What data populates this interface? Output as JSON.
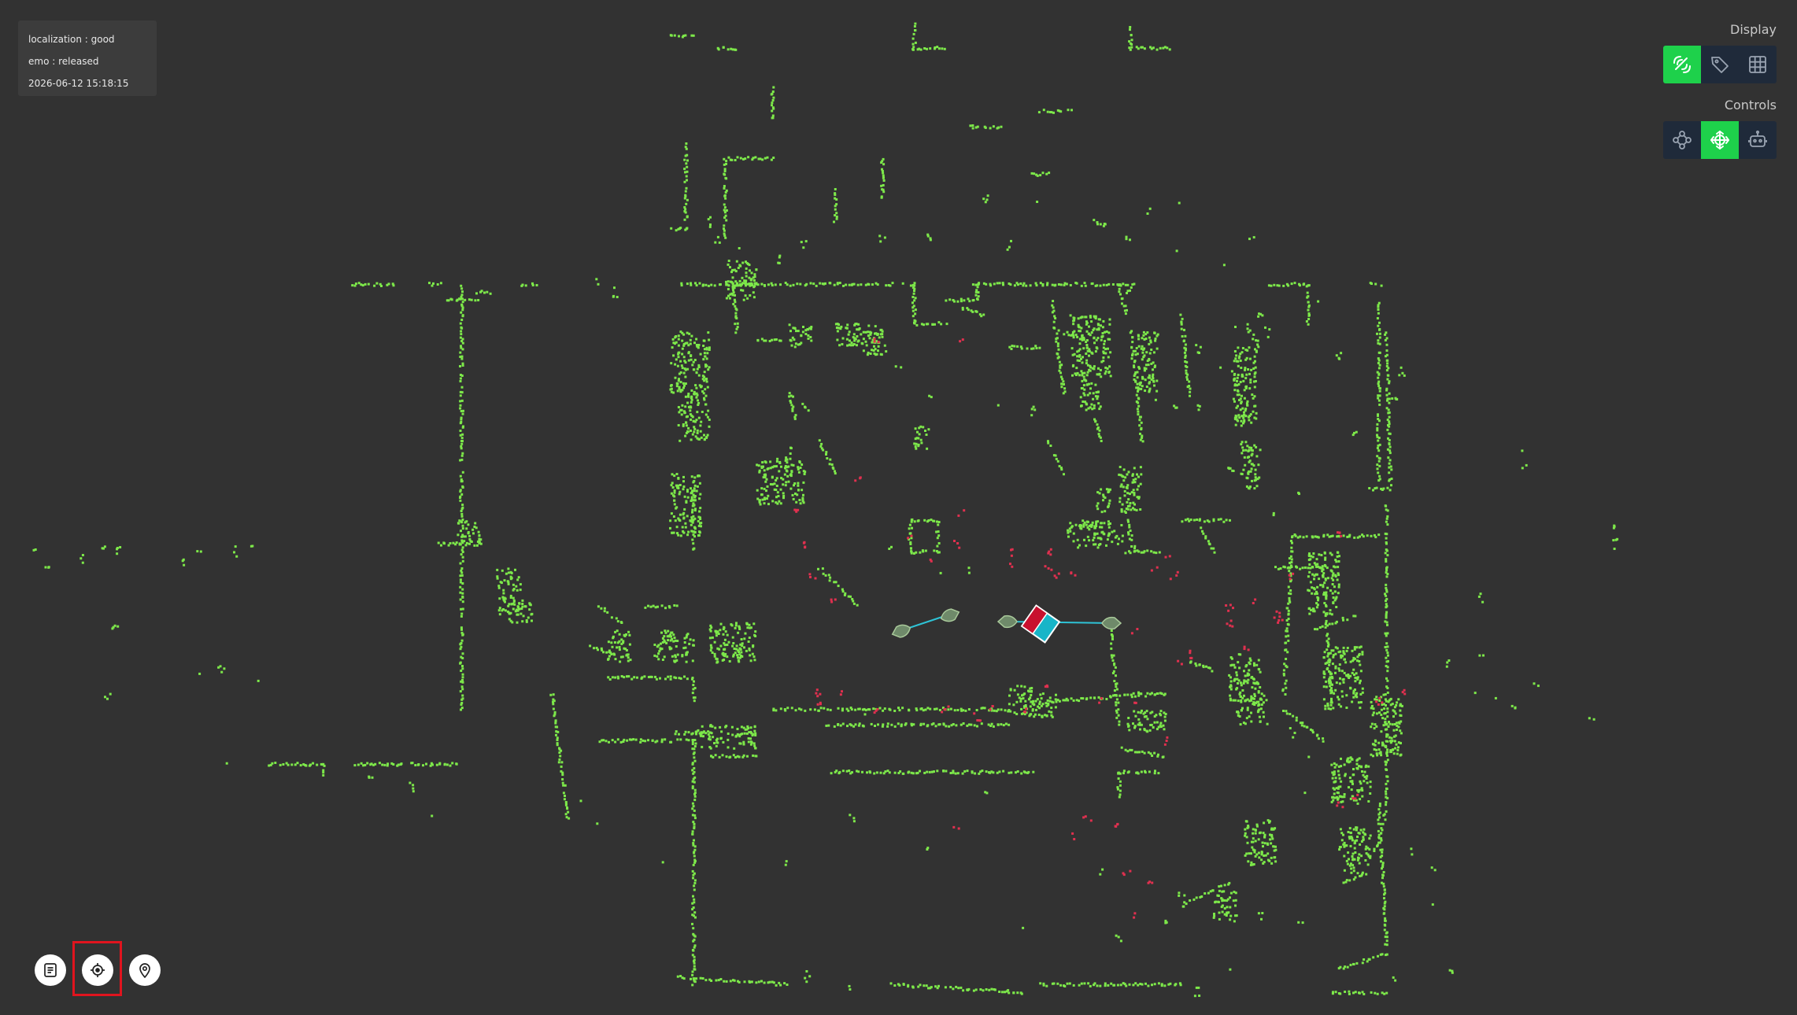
{
  "status": {
    "localization": "localization : good",
    "emo": "emo : released",
    "timestamp": "2026-06-12 15:18:15"
  },
  "display": {
    "title": "Display",
    "buttons": [
      {
        "icon": "laser-scan-icon",
        "active": true
      },
      {
        "icon": "tag-icon",
        "active": false
      },
      {
        "icon": "grid-icon",
        "active": false
      }
    ]
  },
  "controls": {
    "title": "Controls",
    "buttons": [
      {
        "icon": "waypoints-icon",
        "active": false
      },
      {
        "icon": "move-arrows-icon",
        "active": true
      },
      {
        "icon": "robot-icon",
        "active": false
      }
    ]
  },
  "bottom_toolbar": {
    "buttons": [
      {
        "icon": "list-icon"
      },
      {
        "icon": "locate-target-icon",
        "highlighted": true
      },
      {
        "icon": "map-pin-icon"
      }
    ]
  },
  "colors": {
    "background": "#323232",
    "map_points": "#7de84a",
    "laser_points": "#e0304f",
    "active_button": "#1ed14b",
    "inactive_button": "#1f2a3a",
    "path": "#2ec3d6",
    "highlight": "#e0141e"
  }
}
